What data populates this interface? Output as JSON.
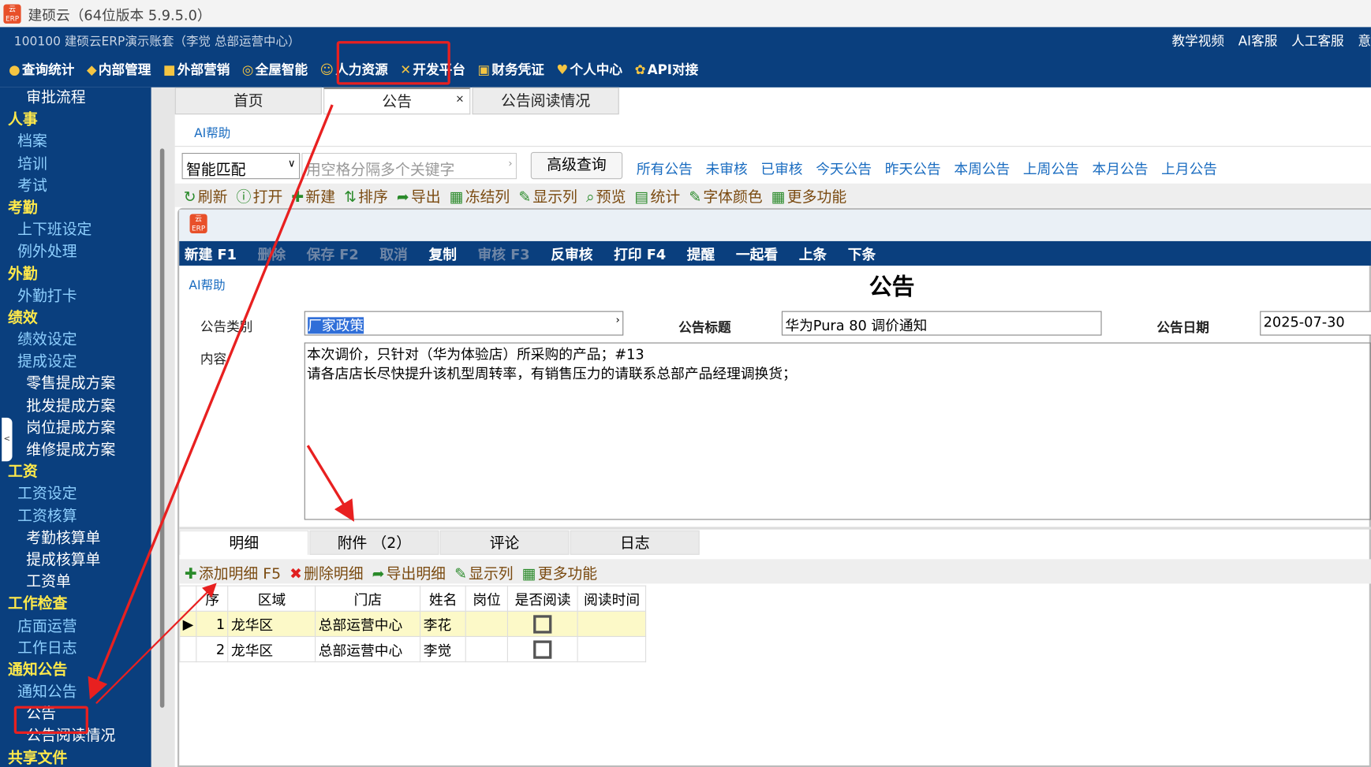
{
  "window": {
    "title": "建硕云（64位版本 5.9.5.0）",
    "logo": "云ERP"
  },
  "account": "100100 建硕云ERP演示账套（李觉 总部运营中心）",
  "right_links": [
    "教学视频",
    "AI客服",
    "人工客服",
    "意"
  ],
  "main_menu": [
    "查询统计",
    "内部管理",
    "外部营销",
    "全屋智能",
    "人力资源",
    "开发平台",
    "财务凭证",
    "个人中心",
    "API对接"
  ],
  "sidebar": [
    {
      "t": "审批流程",
      "l": 2
    },
    {
      "t": "人事",
      "l": 0
    },
    {
      "t": "档案",
      "l": 1
    },
    {
      "t": "培训",
      "l": 1
    },
    {
      "t": "考试",
      "l": 1
    },
    {
      "t": "考勤",
      "l": 0
    },
    {
      "t": "上下班设定",
      "l": 1
    },
    {
      "t": "例外处理",
      "l": 1
    },
    {
      "t": "外勤",
      "l": 0
    },
    {
      "t": "外勤打卡",
      "l": 1
    },
    {
      "t": "绩效",
      "l": 0
    },
    {
      "t": "绩效设定",
      "l": 1
    },
    {
      "t": "提成设定",
      "l": 1
    },
    {
      "t": "零售提成方案",
      "l": 2
    },
    {
      "t": "批发提成方案",
      "l": 2
    },
    {
      "t": "岗位提成方案",
      "l": 2
    },
    {
      "t": "维修提成方案",
      "l": 2
    },
    {
      "t": "工资",
      "l": 0
    },
    {
      "t": "工资设定",
      "l": 1
    },
    {
      "t": "工资核算",
      "l": 1
    },
    {
      "t": "考勤核算单",
      "l": 2
    },
    {
      "t": "提成核算单",
      "l": 2
    },
    {
      "t": "工资单",
      "l": 2
    },
    {
      "t": "工作检查",
      "l": 0
    },
    {
      "t": "店面运营",
      "l": 1
    },
    {
      "t": "工作日志",
      "l": 1
    },
    {
      "t": "通知公告",
      "l": 0
    },
    {
      "t": "通知公告",
      "l": 1
    },
    {
      "t": "公告",
      "l": 2
    },
    {
      "t": "公告阅读情况",
      "l": 2
    },
    {
      "t": "共享文件",
      "l": 0
    }
  ],
  "tabs": [
    "首页",
    "公告",
    "公告阅读情况"
  ],
  "tab_close": "×",
  "ai_help": "AI帮助",
  "search": {
    "mode": "智能匹配",
    "placeholder": "用空格分隔多个关键字",
    "advanced": "高级查询"
  },
  "filters": [
    "所有公告",
    "未审核",
    "已审核",
    "今天公告",
    "昨天公告",
    "本周公告",
    "上周公告",
    "本月公告",
    "上月公告"
  ],
  "list_toolbar": [
    "刷新",
    "打开",
    "新建",
    "排序",
    "导出",
    "冻结列",
    "显示列",
    "预览",
    "统计",
    "字体颜色",
    "更多功能"
  ],
  "form_toolbar": [
    {
      "t": "新建 F1",
      "d": false
    },
    {
      "t": "删除",
      "d": true
    },
    {
      "t": "保存 F2",
      "d": true
    },
    {
      "t": "取消",
      "d": true
    },
    {
      "t": "复制",
      "d": false
    },
    {
      "t": "审核 F3",
      "d": true
    },
    {
      "t": "反审核",
      "d": false
    },
    {
      "t": "打印 F4",
      "d": false
    },
    {
      "t": "提醒",
      "d": false
    },
    {
      "t": "一起看",
      "d": false
    },
    {
      "t": "上条",
      "d": false
    },
    {
      "t": "下条",
      "d": false
    }
  ],
  "form": {
    "title": "公告",
    "category_label": "公告类别",
    "category": "厂家政策",
    "subject_label": "公告标题",
    "subject": "华为Pura 80 调价通知",
    "date_label": "公告日期",
    "date": "2025-07-30",
    "content_label": "内容",
    "content": [
      "本次调价，只针对（华为体验店）所采购的产品；#13",
      "请各店店长尽快提升该机型周转率，有销售压力的请联系总部产品经理调换货；"
    ]
  },
  "bottom_tabs": [
    "明细",
    "附件 （2）",
    "评论",
    "日志"
  ],
  "detail_toolbar": [
    "添加明细 F5",
    "删除明细",
    "导出明细",
    "显示列",
    "更多功能"
  ],
  "table": {
    "headers": [
      "序",
      "区域",
      "门店",
      "姓名",
      "岗位",
      "是否阅读",
      "阅读时间"
    ],
    "rows": [
      [
        "1",
        "龙华区",
        "总部运营中心",
        "李花",
        "",
        false,
        ""
      ],
      [
        "2",
        "龙华区",
        "总部运营中心",
        "李觉",
        "",
        false,
        ""
      ]
    ]
  }
}
